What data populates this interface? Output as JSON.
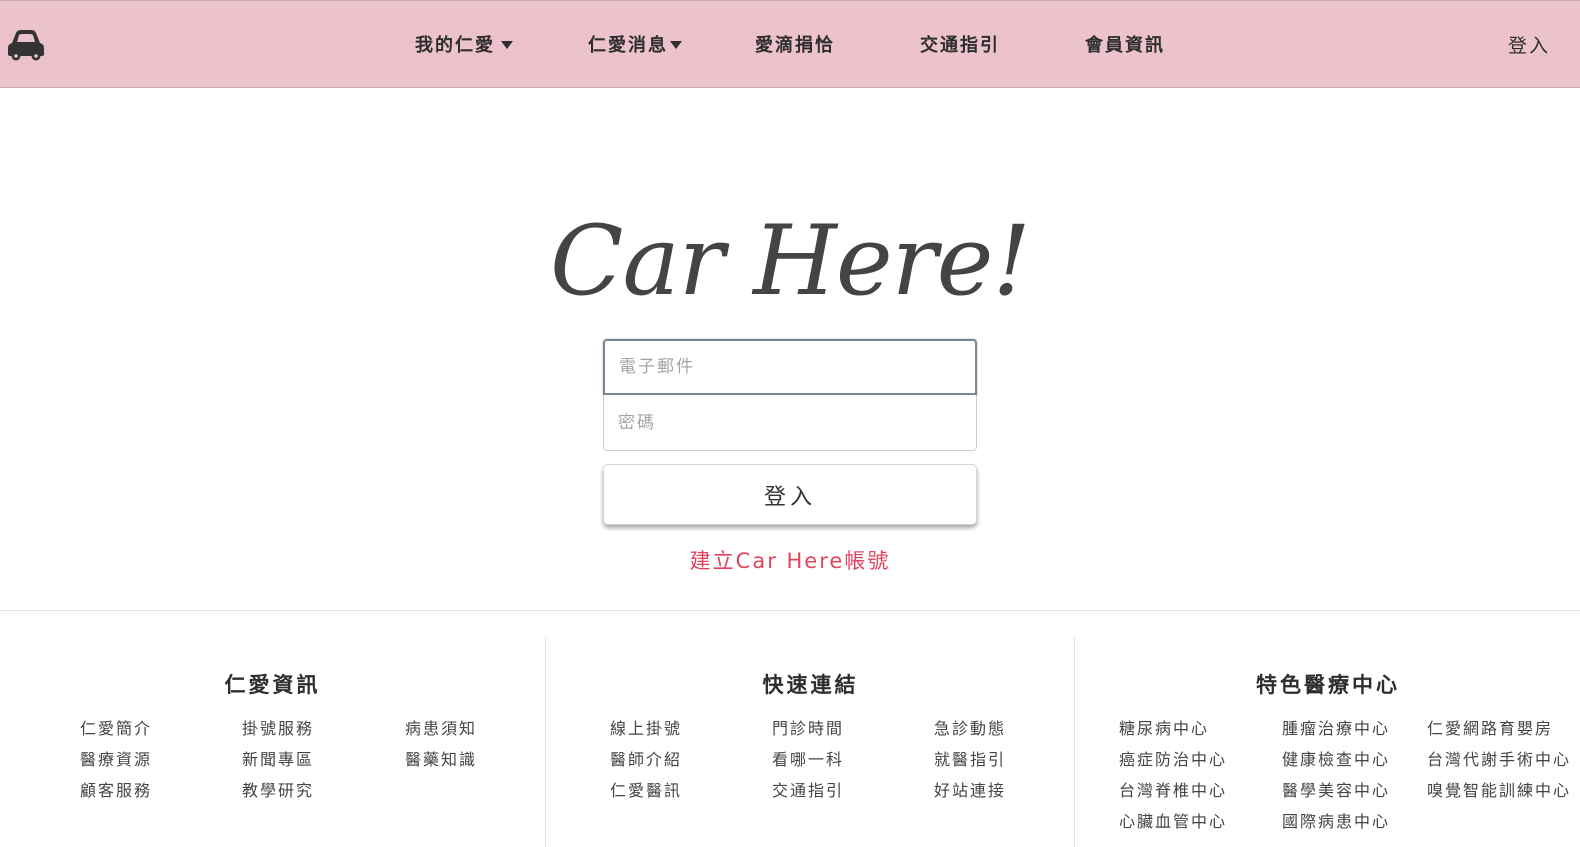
{
  "nav": {
    "brand_icon": "car-icon",
    "items": [
      {
        "label": "我的仁愛",
        "dropdown": true
      },
      {
        "label": "仁愛消息",
        "dropdown": true
      },
      {
        "label": "愛滴捐恰",
        "dropdown": false
      },
      {
        "label": "交通指引",
        "dropdown": false
      },
      {
        "label": "會員資訊",
        "dropdown": false
      }
    ],
    "login_label": "登入"
  },
  "hero": {
    "title": "Car Here!"
  },
  "login_form": {
    "email_placeholder": "電子郵件",
    "password_placeholder": "密碼",
    "submit_label": "登入"
  },
  "signup_link": "建立Car Here帳號",
  "footer": {
    "columns": [
      {
        "heading": "仁愛資訊",
        "links": [
          "仁愛簡介",
          "掛號服務",
          "病患須知",
          "醫療資源",
          "新聞專區",
          "醫藥知識",
          "顧客服務",
          "教學研究"
        ]
      },
      {
        "heading": "快速連結",
        "links": [
          "線上掛號",
          "門診時間",
          "急診動態",
          "醫師介紹",
          "看哪一科",
          "就醫指引",
          "仁愛醫訊",
          "交通指引",
          "好站連接"
        ]
      },
      {
        "heading": "特色醫療中心",
        "links": [
          "糖尿病中心",
          "腫瘤治療中心",
          "仁愛網路育嬰房",
          "癌症防治中心",
          "健康檢查中心",
          "台灣代謝手術中心",
          "台灣脊椎中心",
          "醫學美容中心",
          "嗅覺智能訓練中心",
          "心臟血管中心",
          "國際病患中心"
        ]
      }
    ]
  },
  "colors": {
    "navbar_bg": "#ecc2cc",
    "link_accent": "#e2445f"
  }
}
